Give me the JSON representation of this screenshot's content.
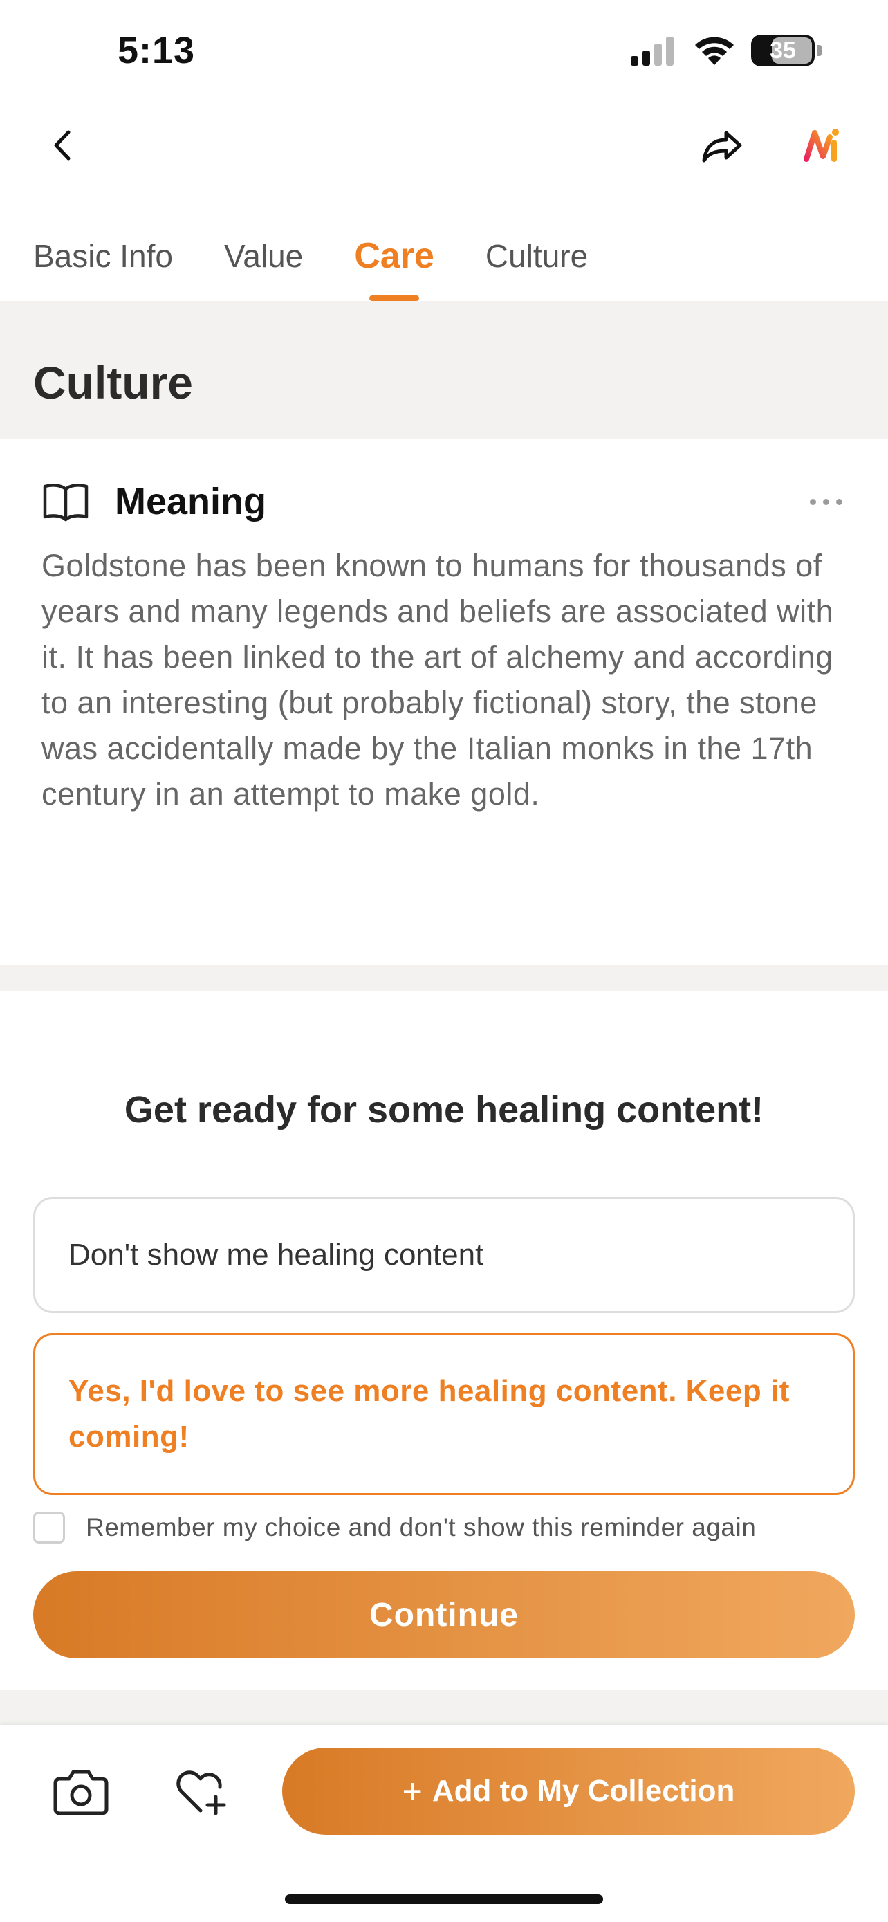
{
  "status_bar": {
    "time": "5:13",
    "battery": "35"
  },
  "tabs": [
    {
      "label": "Basic Info",
      "active": false
    },
    {
      "label": "Value",
      "active": false
    },
    {
      "label": "Care",
      "active": true
    },
    {
      "label": "Culture",
      "active": false
    }
  ],
  "section": {
    "title": "Culture"
  },
  "meaning": {
    "title": "Meaning",
    "text": "Goldstone has been known to humans for thousands of years and many legends and beliefs are associated with it. It has been linked to the art of alchemy and according to an interesting (but probably fictional) story, the stone was accidentally made by the Italian monks in the 17th century in an attempt to make gold."
  },
  "healing": {
    "title": "Get ready for some healing content!",
    "option_no": "Don't show me healing content",
    "option_yes": "Yes, I'd love to see more healing content. Keep it coming!",
    "remember_label": "Remember my choice and don't show this reminder again",
    "continue_label": "Continue"
  },
  "bottom_bar": {
    "add_label": "Add to My Collection",
    "plus_symbol": "+"
  },
  "colors": {
    "accent": "#ee7f22",
    "gradient_start": "#d87a26",
    "gradient_end": "#f0a85e",
    "band": "#f3f2f0"
  },
  "icons": [
    "back-icon",
    "share-icon",
    "app-logo-icon",
    "book-icon",
    "more-icon",
    "camera-icon",
    "heart-plus-icon",
    "signal-icon",
    "wifi-icon",
    "battery-icon"
  ]
}
